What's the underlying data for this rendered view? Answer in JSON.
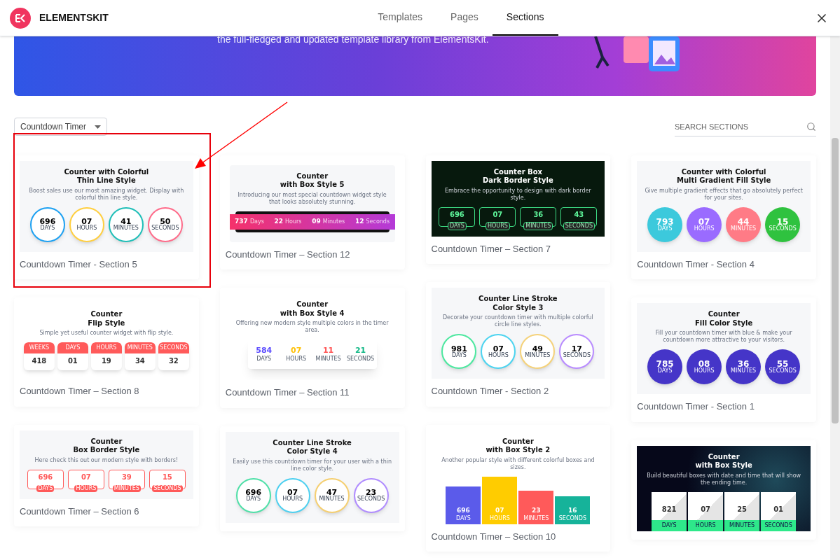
{
  "header": {
    "brand": "ELEMENTSKIT",
    "tabs": [
      {
        "label": "Templates",
        "selected": false
      },
      {
        "label": "Pages",
        "selected": false
      },
      {
        "label": "Sections",
        "selected": true
      }
    ]
  },
  "banner": {
    "text": "the full-fledged and updated template library from ElementsKit."
  },
  "filter": {
    "category": "Countdown Timer",
    "search_placeholder": "SEARCH SECTIONS"
  },
  "columns": [
    [
      {
        "label": "Countdown Timer - Section 5",
        "highlighted": true,
        "preview": {
          "kind": "ring",
          "title": "Counter with Colorful",
          "title_2": "Thin Line Style",
          "subtitle": "Boost sales use our most amazing widget. Display with colorful thin line style.",
          "counters": [
            {
              "value": "696",
              "unit": "DAYS",
              "color": "#1da1f2"
            },
            {
              "value": "07",
              "unit": "HOURS",
              "color": "#ffcf40"
            },
            {
              "value": "41",
              "unit": "MINUTES",
              "color": "#1fbfb8"
            },
            {
              "value": "50",
              "unit": "SECONDS",
              "color": "#ff6b8a"
            }
          ]
        }
      },
      {
        "label": "Countdown Timer – Section 8",
        "highlighted": false,
        "preview": {
          "kind": "flip",
          "title": "Counter",
          "title_2": "Flip Style",
          "subtitle": "Simple yet useful counter widget with flip style.",
          "counters": [
            {
              "value": "418",
              "unit": "WEEKS"
            },
            {
              "value": "01",
              "unit": "DAYS"
            },
            {
              "value": "19",
              "unit": "HOURS"
            },
            {
              "value": "34",
              "unit": "MINUTES"
            },
            {
              "value": "32",
              "unit": "SECONDS"
            }
          ]
        }
      },
      {
        "label": "Countdown Timer – Section 6",
        "highlighted": false,
        "preview": {
          "kind": "border",
          "title": "Counter",
          "title_2": "Box Border Style",
          "subtitle": "Here check this out our modern style with borders!",
          "counters": [
            {
              "value": "696",
              "unit": "DAYS"
            },
            {
              "value": "07",
              "unit": "HOURS"
            },
            {
              "value": "39",
              "unit": "MINUTES"
            },
            {
              "value": "15",
              "unit": "SECONDS"
            }
          ]
        }
      }
    ],
    [
      {
        "label": "Countdown Timer – Section 12",
        "highlighted": false,
        "preview": {
          "kind": "bar",
          "title": "Counter",
          "title_2": "with Box Style 5",
          "subtitle": "Introducing our most special countdown widget style that looks absolutely stunning.",
          "counters": [
            {
              "value": "737",
              "unit": "Days"
            },
            {
              "value": "22",
              "unit": "Hours"
            },
            {
              "value": "09",
              "unit": "Minutes"
            },
            {
              "value": "12",
              "unit": "Seconds"
            }
          ]
        }
      },
      {
        "label": "Countdown Timer – Section 11",
        "highlighted": false,
        "preview": {
          "kind": "card",
          "title": "Counter",
          "title_2": "with Box Style 4",
          "subtitle": "Offering new modern style multiple colors in the timer area.",
          "counters": [
            {
              "value": "584",
              "unit": "DAYS",
              "color": "#5a4bff"
            },
            {
              "value": "07",
              "unit": "HOURS",
              "color": "#ffc107"
            },
            {
              "value": "11",
              "unit": "MINUTES",
              "color": "#ff5252"
            },
            {
              "value": "21",
              "unit": "SECONDS",
              "color": "#12b886"
            }
          ]
        }
      },
      {
        "highlighted": false,
        "preview": {
          "kind": "ring",
          "title": "Counter Line Stroke",
          "title_2": "Color Style 4",
          "subtitle": "Easily use this countdown timer for your user with a thin line color style.",
          "counters": [
            {
              "value": "696",
              "unit": "DAYS",
              "color": "#4fe0a8"
            },
            {
              "value": "07",
              "unit": "HOURS",
              "color": "#4dd0f0"
            },
            {
              "value": "47",
              "unit": "MINUTES",
              "color": "#f5cf70"
            },
            {
              "value": "23",
              "unit": "SECONDS",
              "color": "#b08cff"
            }
          ]
        }
      }
    ],
    [
      {
        "label": "Countdown Timer – Section 7",
        "highlighted": false,
        "preview": {
          "kind": "dark",
          "title": "Counter Box",
          "title_2": "Dark Border Style",
          "subtitle": "Embrace the opportunity to design with dark border style.",
          "counters": [
            {
              "value": "696",
              "unit": "DAYS"
            },
            {
              "value": "07",
              "unit": "HOURS"
            },
            {
              "value": "36",
              "unit": "MINUTES"
            },
            {
              "value": "43",
              "unit": "SECONDS"
            }
          ]
        }
      },
      {
        "label": "Countdown Timer - Section 2",
        "highlighted": false,
        "preview": {
          "kind": "ring",
          "title": "Counter Line Stroke",
          "title_2": "Color Style 3",
          "subtitle": "Decorate your countdown timer with multiple colorful circle line styles.",
          "counters": [
            {
              "value": "981",
              "unit": "DAYS",
              "color": "#4de8a0"
            },
            {
              "value": "07",
              "unit": "HOURS",
              "color": "#4dd4f0"
            },
            {
              "value": "49",
              "unit": "MINUTES",
              "color": "#f5d27a"
            },
            {
              "value": "17",
              "unit": "SECONDS",
              "color": "#b98cff"
            }
          ]
        }
      },
      {
        "label": "Countdown Timer – Section 10",
        "highlighted": false,
        "preview": {
          "kind": "column",
          "title": "Counter",
          "title_2": "with Box Style 2",
          "subtitle": "Another popular style with different colorful boxes and sizes.",
          "counters": [
            {
              "value": "696",
              "unit": "DAYS",
              "color": "#5b5bea"
            },
            {
              "value": "07",
              "unit": "HOURS",
              "color": "#ffcc00"
            },
            {
              "value": "23",
              "unit": "MINUTES",
              "color": "#ff5a5a"
            },
            {
              "value": "16",
              "unit": "SECONDS",
              "color": "#16b39a"
            }
          ]
        }
      }
    ],
    [
      {
        "label": "Countdown Timer - Section 4",
        "highlighted": false,
        "preview": {
          "kind": "disc",
          "title": "Counter with Colorful",
          "title_2": "Multi Gradient Fill Style",
          "subtitle": "Give multiple gradient effects that go absolutely perfect for your sites.",
          "counters": [
            {
              "value": "793",
              "unit": "DAYS",
              "color": "#3cc9dc"
            },
            {
              "value": "07",
              "unit": "HOURS",
              "color": "#9a6bff"
            },
            {
              "value": "44",
              "unit": "MINUTES",
              "color": "#ff7b86"
            },
            {
              "value": "15",
              "unit": "SECONDS",
              "color": "#2fc23f"
            }
          ]
        }
      },
      {
        "label": "Countdown Timer - Section 1",
        "highlighted": false,
        "preview": {
          "kind": "disc",
          "title": "Counter",
          "title_2": "Fill Color Style",
          "subtitle": "Fill your countdown timer with blue & make your countdown more attractive to your visitors.",
          "counters": [
            {
              "value": "785",
              "unit": "DAYS",
              "color": "#4535c8"
            },
            {
              "value": "08",
              "unit": "HOURS",
              "color": "#4535c8"
            },
            {
              "value": "36",
              "unit": "MINUTES",
              "color": "#4535c8"
            },
            {
              "value": "55",
              "unit": "SECONDS",
              "color": "#4535c8"
            }
          ]
        }
      },
      {
        "highlighted": false,
        "preview": {
          "kind": "photo",
          "title": "Counter",
          "title_2": "with Box Style",
          "subtitle": "Build beautiful boxes with date and time that will show the ending time.",
          "counters": [
            {
              "value": "821",
              "unit": "DAYS"
            },
            {
              "value": "07",
              "unit": "HOURS"
            },
            {
              "value": "25",
              "unit": "MINUTES"
            },
            {
              "value": "01",
              "unit": "SECONDS"
            }
          ]
        }
      }
    ]
  ]
}
